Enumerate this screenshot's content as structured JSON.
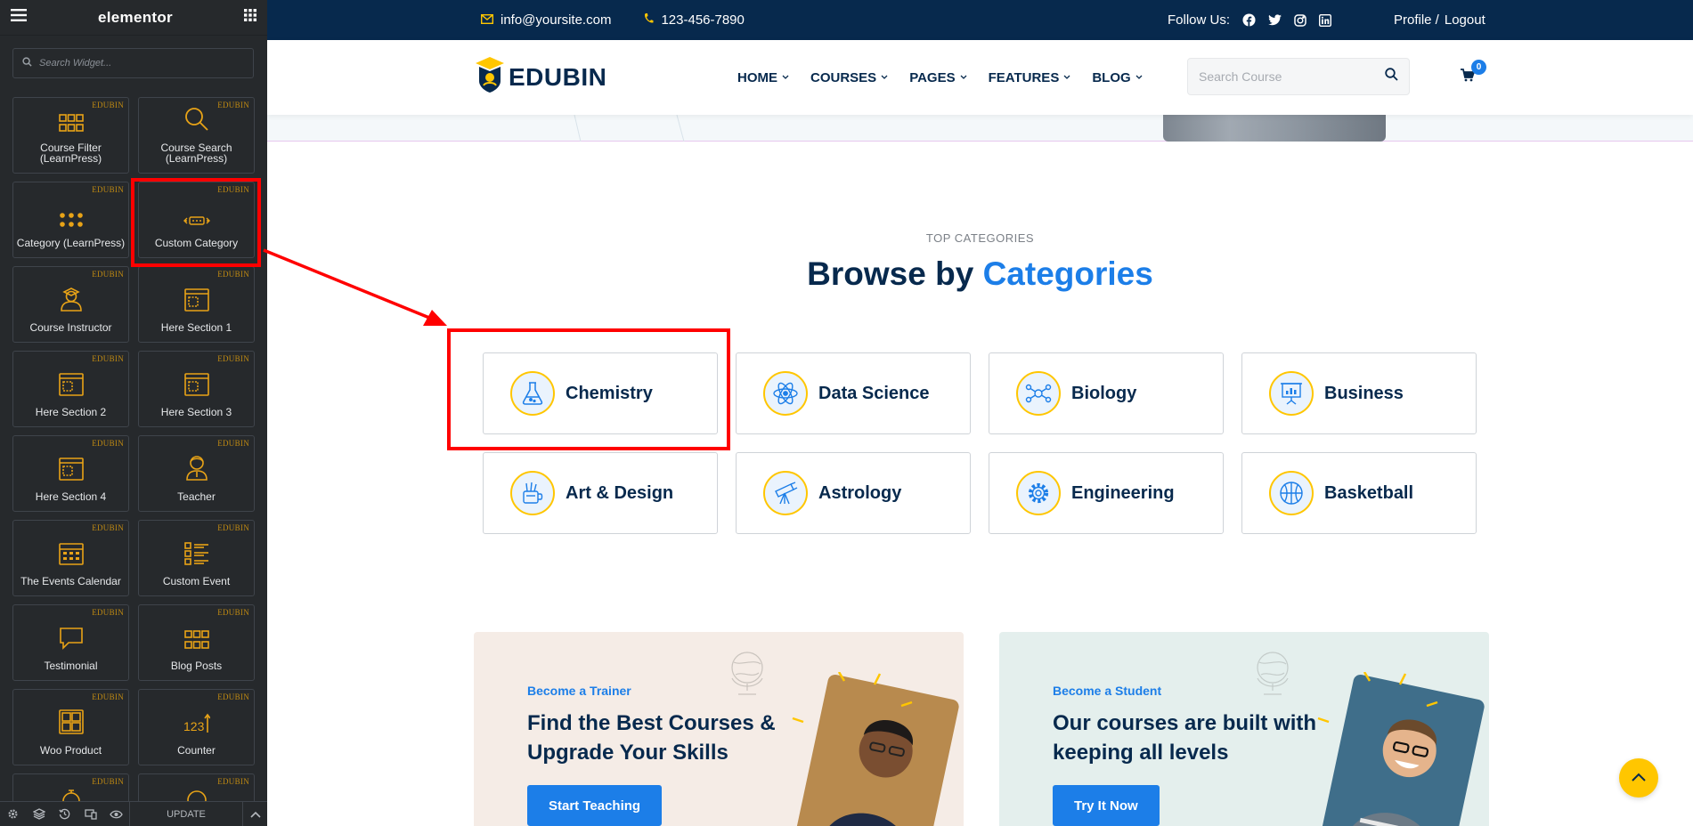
{
  "elementor": {
    "logo": "elementor",
    "search_placeholder": "Search Widget...",
    "tag": "EDUBIN",
    "widgets": [
      {
        "label1": "Course Filter",
        "label2": "(LearnPress)",
        "icon": "grid-icon"
      },
      {
        "label1": "Course Search",
        "label2": "(LearnPress)",
        "icon": "magnifier-icon"
      },
      {
        "label1": "Category (LearnPress)",
        "label2": "",
        "icon": "dots-grid-icon"
      },
      {
        "label1": "Custom Category",
        "label2": "",
        "icon": "tag-arrows-icon"
      },
      {
        "label1": "Course Instructor",
        "label2": "",
        "icon": "instructor-icon"
      },
      {
        "label1": "Here Section 1",
        "label2": "",
        "icon": "section-icon"
      },
      {
        "label1": "Here Section 2",
        "label2": "",
        "icon": "section-icon"
      },
      {
        "label1": "Here Section 3",
        "label2": "",
        "icon": "section-icon"
      },
      {
        "label1": "Here Section 4",
        "label2": "",
        "icon": "section-icon"
      },
      {
        "label1": "Teacher",
        "label2": "",
        "icon": "teacher-icon"
      },
      {
        "label1": "The Events Calendar",
        "label2": "",
        "icon": "calendar-icon"
      },
      {
        "label1": "Custom Event",
        "label2": "",
        "icon": "list-icon"
      },
      {
        "label1": "Testimonial",
        "label2": "",
        "icon": "speech-bubble-icon"
      },
      {
        "label1": "Blog Posts",
        "label2": "",
        "icon": "blog-grid-icon"
      },
      {
        "label1": "Woo Product",
        "label2": "",
        "icon": "product-icon"
      },
      {
        "label1": "Counter",
        "label2": "",
        "icon": "counter-icon"
      }
    ],
    "footer": {
      "update": "UPDATE"
    }
  },
  "site": {
    "topbar": {
      "email": "info@yoursite.com",
      "phone": "123-456-7890",
      "follow": "Follow Us:",
      "profile": "Profile /",
      "logout": "Logout"
    },
    "brand": "EDUBIN",
    "menu": [
      "HOME",
      "COURSES",
      "PAGES",
      "FEATURES",
      "BLOG"
    ],
    "search_placeholder": "Search Course",
    "cart_count": "0",
    "section": {
      "subtitle": "TOP CATEGORIES",
      "title_a": "Browse by",
      "title_b": "Categories"
    },
    "categories": [
      {
        "label": "Chemistry",
        "icon": "flask-icon"
      },
      {
        "label": "Data Science",
        "icon": "atom-icon"
      },
      {
        "label": "Biology",
        "icon": "molecule-icon"
      },
      {
        "label": "Business",
        "icon": "presentation-icon"
      },
      {
        "label": "Art & Design",
        "icon": "art-supplies-icon"
      },
      {
        "label": "Astrology",
        "icon": "telescope-icon"
      },
      {
        "label": "Engineering",
        "icon": "gear-icon"
      },
      {
        "label": "Basketball",
        "icon": "basketball-icon"
      }
    ],
    "promos": [
      {
        "kicker": "Become a Trainer",
        "title": "Find the Best Courses & Upgrade Your Skills",
        "button": "Start Teaching"
      },
      {
        "kicker": "Become a Student",
        "title": "Our courses are built with keeping all levels",
        "button": "Try It Now"
      }
    ]
  },
  "colors": {
    "panel_bg": "#26292c",
    "widget_icon": "#e8a317",
    "navy": "#07294d",
    "accent_blue": "#1c7ee8",
    "yellow": "#ffc600",
    "annotation_red": "#ff0000"
  }
}
